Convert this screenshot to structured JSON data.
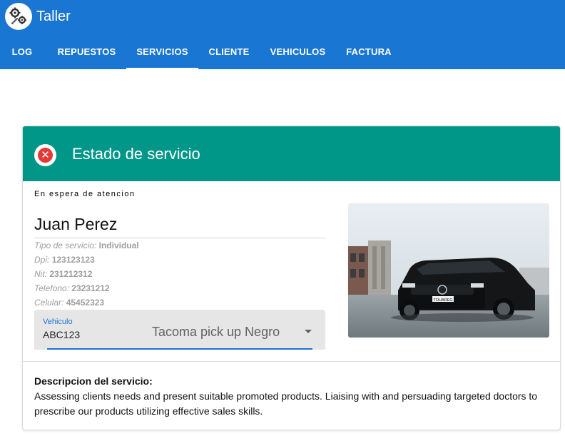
{
  "app": {
    "title": "Taller",
    "logo_icon": "gears-wrench-icon"
  },
  "nav": {
    "tabs": [
      {
        "label": "LOG"
      },
      {
        "label": "REPUESTOS"
      },
      {
        "label": "SERVICIOS",
        "active": true
      },
      {
        "label": "CLIENTE"
      },
      {
        "label": "VEHICULOS"
      },
      {
        "label": "FACTURA"
      }
    ]
  },
  "card": {
    "title": "Estado de servicio",
    "status_icon": "close-circle-icon",
    "status_text": "En espera de atencion",
    "client_name": "Juan Perez",
    "info": [
      {
        "label": "Tipo de servicio:",
        "value": "Individual"
      },
      {
        "label": "Dpi:",
        "value": "123123123"
      },
      {
        "label": "Nit:",
        "value": "231212312"
      },
      {
        "label": "Telefono:",
        "value": "23231212"
      },
      {
        "label": "Celular:",
        "value": "45452323"
      }
    ],
    "vehicle_select": {
      "label": "Vehiculo",
      "plate": "ABC123",
      "value": "Tacoma pick up Negro"
    },
    "photo": {
      "plate_text": "TOUAREG"
    },
    "description": {
      "title": "Descripcion del servicio:",
      "text": "Assessing clients needs and present suitable promoted products. Liaising with and persuading targeted doctors to prescribe our products utilizing effective sales skills."
    }
  },
  "colors": {
    "appbar": "#1976d2",
    "card_header": "#009688",
    "status_icon": "#e53935"
  }
}
